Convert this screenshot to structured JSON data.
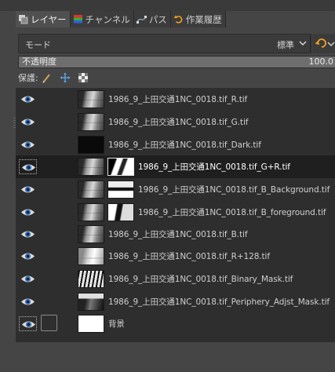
{
  "tabs": [
    {
      "label": "レイヤー",
      "icon": "layers-icon",
      "active": true
    },
    {
      "label": "チャンネル",
      "icon": "channels-icon",
      "active": false
    },
    {
      "label": "パス",
      "icon": "paths-icon",
      "active": false
    },
    {
      "label": "作業履歴",
      "icon": "undo-history-icon",
      "active": false
    }
  ],
  "mode": {
    "label": "モード",
    "value": "標準"
  },
  "opacity": {
    "label": "不透明度",
    "value": "100.0",
    "fraction": 1.0
  },
  "lock": {
    "label": "保護:"
  },
  "layers": [
    {
      "name": "1986_9_上田交通1NC_0018.tif_R.tif",
      "thumb": "photo",
      "mask": null,
      "selected": false
    },
    {
      "name": "1986_9_上田交通1NC_0018.tif_G.tif",
      "thumb": "photo",
      "mask": null,
      "selected": false
    },
    {
      "name": "1986_9_上田交通1NC_0018.tif_Dark.tif",
      "thumb": "dark",
      "mask": null,
      "selected": false
    },
    {
      "name": "1986_9_上田交通1NC_0018.tif_G+R.tif",
      "thumb": "photo",
      "mask": "m1",
      "selected": true
    },
    {
      "name": "1986_9_上田交通1NC_0018.tif_B_Background.tif",
      "thumb": "photo",
      "mask": "m2",
      "selected": false
    },
    {
      "name": "1986_9_上田交通1NC_0018.tif_B_foreground.tif",
      "thumb": "photo",
      "mask": "m3",
      "selected": false
    },
    {
      "name": "1986_9_上田交通1NC_0018.tif_B.tif",
      "thumb": "photo",
      "mask": null,
      "selected": false
    },
    {
      "name": "1986_9_上田交通1NC_0018.tif_R+128.tif",
      "thumb": "light",
      "mask": null,
      "selected": false
    },
    {
      "name": "1986_9_上田交通1NC_0018.tif_Binary_Mask.tif",
      "thumb": "binary",
      "mask": null,
      "selected": false
    },
    {
      "name": "1986_9_上田交通1NC_0018.tif_Periphery_Adjst_Mask.tif",
      "thumb": "periph",
      "mask": null,
      "selected": false
    },
    {
      "name": "背景",
      "thumb": "white",
      "mask": null,
      "selected": false,
      "background": true
    }
  ]
}
